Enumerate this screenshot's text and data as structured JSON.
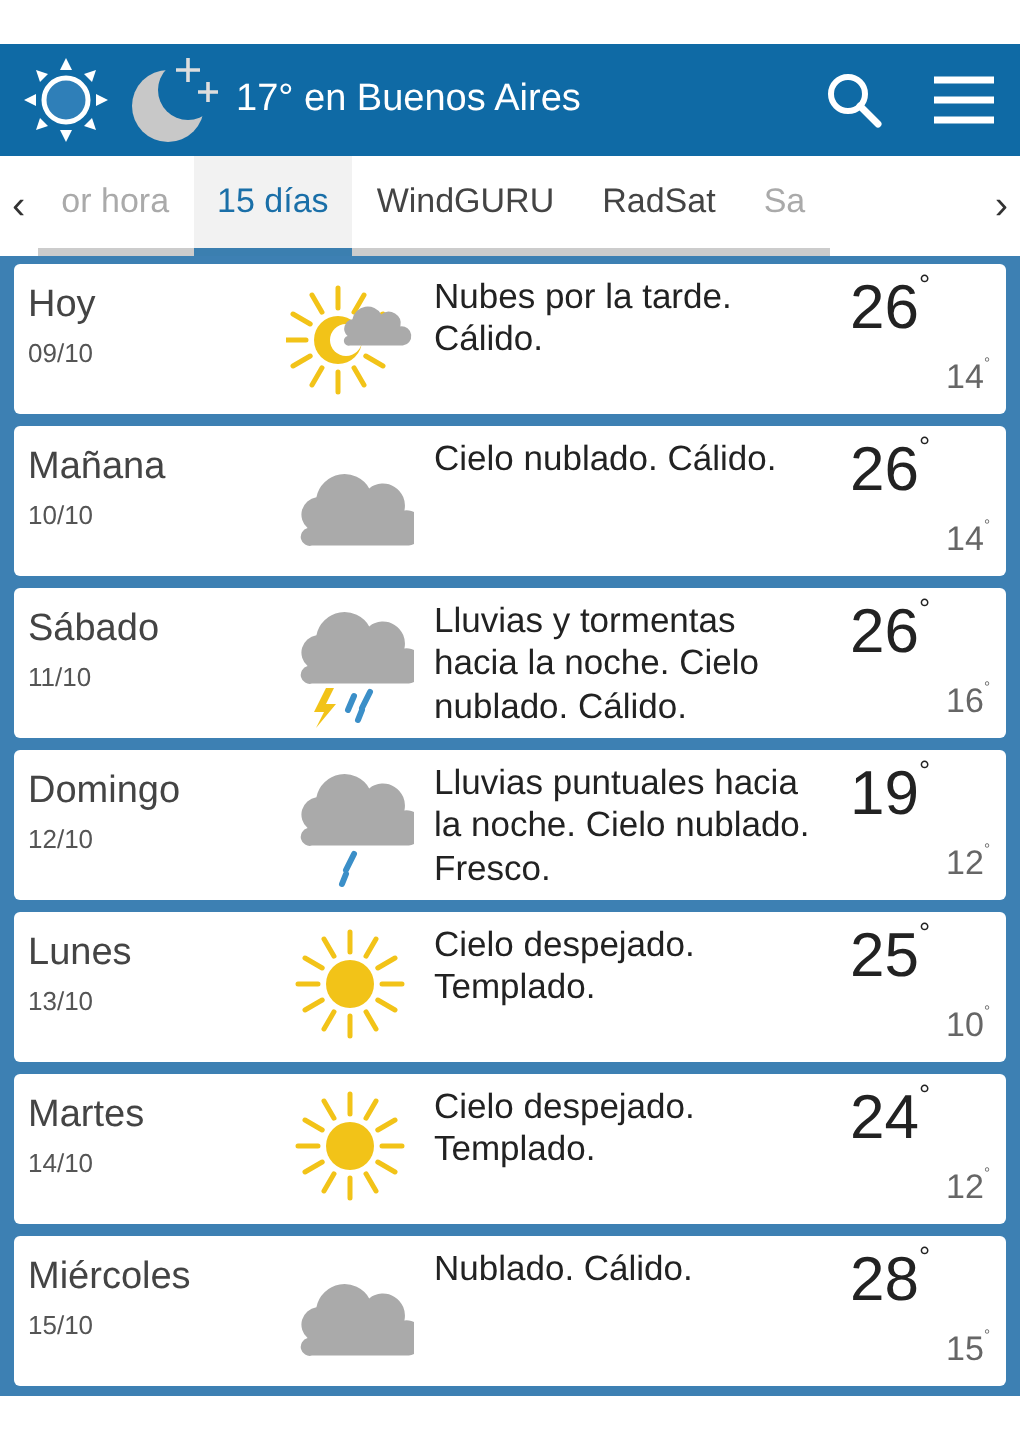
{
  "header": {
    "title": "17° en Buenos Aires"
  },
  "scroll_left": "‹",
  "scroll_right": "›",
  "tabs": [
    {
      "label": "or hora",
      "selected": false
    },
    {
      "label": "15 días",
      "selected": true
    },
    {
      "label": "WindGURU",
      "selected": false
    },
    {
      "label": "RadSat",
      "selected": false
    },
    {
      "label": "Sa",
      "selected": false
    }
  ],
  "days": [
    {
      "day": "Hoy",
      "date": "09/10",
      "kind": "sun_cloud",
      "description": "Nubes por la tarde. Cálido.",
      "max": "26$^{°}$",
      "min": "14$^{°}$"
    },
    {
      "day": "Mañana",
      "date": "10/10",
      "kind": "cloud",
      "description": "Cielo nublado. Cálido.",
      "max": "26$^{°}$",
      "min": "14$^{°}$"
    },
    {
      "day": "Sábado",
      "date": "11/10",
      "kind": "storm",
      "description": "Lluvias y tormentas hacia la noche. Cielo nublado. Cálido.",
      "max": "26$^{°}$",
      "min": "16$^{°}$"
    },
    {
      "day": "Domingo",
      "date": "12/10",
      "kind": "rain",
      "description": "Lluvias puntuales hacia la noche. Cielo nublado. Fresco.",
      "max": "19$^{°}$",
      "min": "12$^{°}$"
    },
    {
      "day": "Lunes",
      "date": "13/10",
      "kind": "sun",
      "description": "Cielo despejado. Templado.",
      "max": "25$^{°}$",
      "min": "10$^{°}$"
    },
    {
      "day": "Martes",
      "date": "14/10",
      "kind": "sun",
      "description": "Cielo despejado. Templado.",
      "max": "24$^{°}$",
      "min": "12$^{°}$"
    },
    {
      "day": "Miércoles",
      "date": "15/10",
      "kind": "cloud",
      "description": "Nublado. Cálido.",
      "max": "28$^{°}$",
      "min": "15$^{°}$"
    }
  ]
}
